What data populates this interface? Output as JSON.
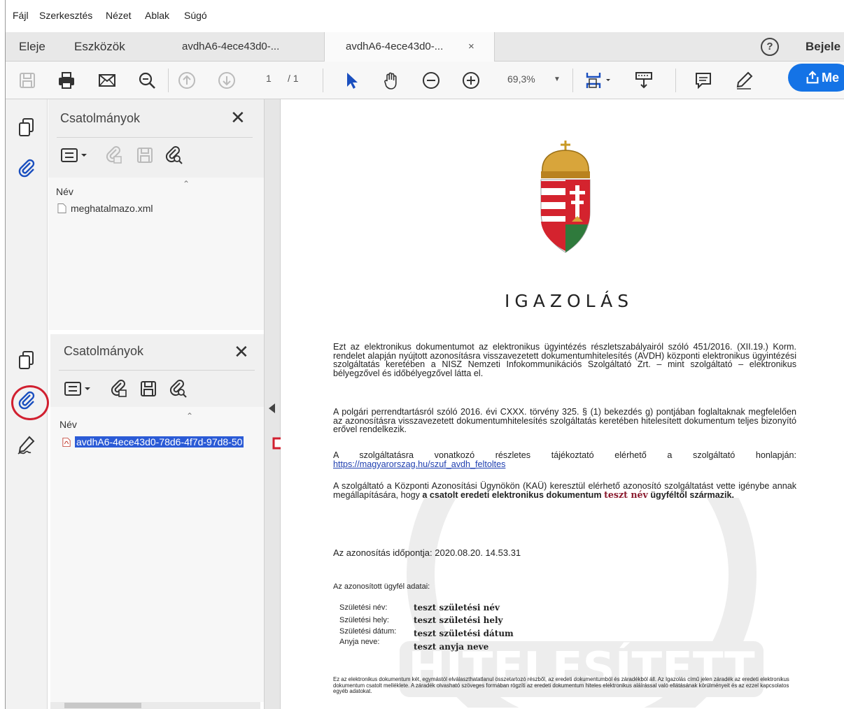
{
  "menu": [
    "Fájl",
    "Szerkesztés",
    "Nézet",
    "Ablak",
    "Súgó"
  ],
  "tabs": {
    "home": "Eleje",
    "tools": "Eszközök",
    "doc1": "avdhA6-4ece43d0-...",
    "doc2": "avdhA6-4ece43d0-...",
    "close": "×",
    "signin": "Bejele"
  },
  "toolbar": {
    "page_current": "1",
    "page_total": "/ 1",
    "zoom": "69,3%",
    "share_label": "Me"
  },
  "attachments_panel_top": {
    "title": "Csatolmányok",
    "col_name": "Név",
    "file": "meghatalmazo.xml"
  },
  "attachments_panel_bottom": {
    "title": "Csatolmányok",
    "col_name": "Név",
    "file": "avdhA6-4ece43d0-78d6-4f7d-97d8-50"
  },
  "document": {
    "title": "IGAZOLÁS",
    "p1": "Ezt az elektronikus dokumentumot az elektronikus ügyintézés részletszabályairól szóló 451/2016. (XII.19.) Korm. rendelet alapján nyújtott azonosításra visszavezetett dokumentumhitelesítés (AVDH) központi elektronikus ügyintézési szolgáltatás keretében a NISZ Nemzeti Infokommunikációs Szolgáltató Zrt. – mint szolgáltató – elektronikus bélyegzővel és időbélyegzővel látta el.",
    "p2": "A polgári perrendtartásról szóló 2016. évi CXXX. törvény 325. § (1) bekezdés g) pontjában foglaltaknak megfelelően az azonosításra visszavezetett dokumentumhitelesítés szolgáltatás keretében hitelesített dokumentum teljes bizonyító erővel rendelkezik.",
    "p3_text": "A szolgáltatásra vonatkozó részletes tájékoztató elérhető a szolgáltató honlapján:",
    "p3_link": "https://magyarorszag.hu/szuf_avdh_feltoltes",
    "p4_a": "A szolgáltató a Központi Azonosítási Ügynökön (KAÜ) keresztül elérhető azonosító szolgáltatást vette igénybe annak megállapítására, hogy",
    "p4_b": "a csatolt eredeti elektronikus dokumentum",
    "p4_name": "teszt név",
    "p4_c": "ügyféltől származik.",
    "time_line": "Az azonosítás időpontja: 2020.08.20. 14.53.31",
    "client_data_title": "Az azonosított ügyfél adatai:",
    "fields": [
      {
        "label": "Születési név:",
        "value": "teszt születési név"
      },
      {
        "label": "Születési hely:",
        "value": "teszt születési hely"
      },
      {
        "label": "Születési dátum:",
        "value": "teszt születési dátum"
      },
      {
        "label": "Anyja neve:",
        "value": "teszt anyja neve"
      }
    ],
    "footer": "Ez az elektronikus dokumentum két, egymástól elválaszthatatlanul összetartozó részből, az eredeti dokumentumból és záradékból áll. Az Igazolás című jelen záradék az eredeti elektronikus dokumentum csatolt melléklete. A záradék olvasható szöveges formában rögzíti az eredeti dokumentum hiteles elektronikus aláírással való ellátásának körülményeit és az ezzel kapcsolatos egyéb adatokat.",
    "watermark_text": "HITELESÍTETT"
  },
  "colors": {
    "accent": "#1473e6",
    "highlight": "#d12030",
    "selection": "#2b5bd6",
    "maroon": "#8a1a2e"
  }
}
